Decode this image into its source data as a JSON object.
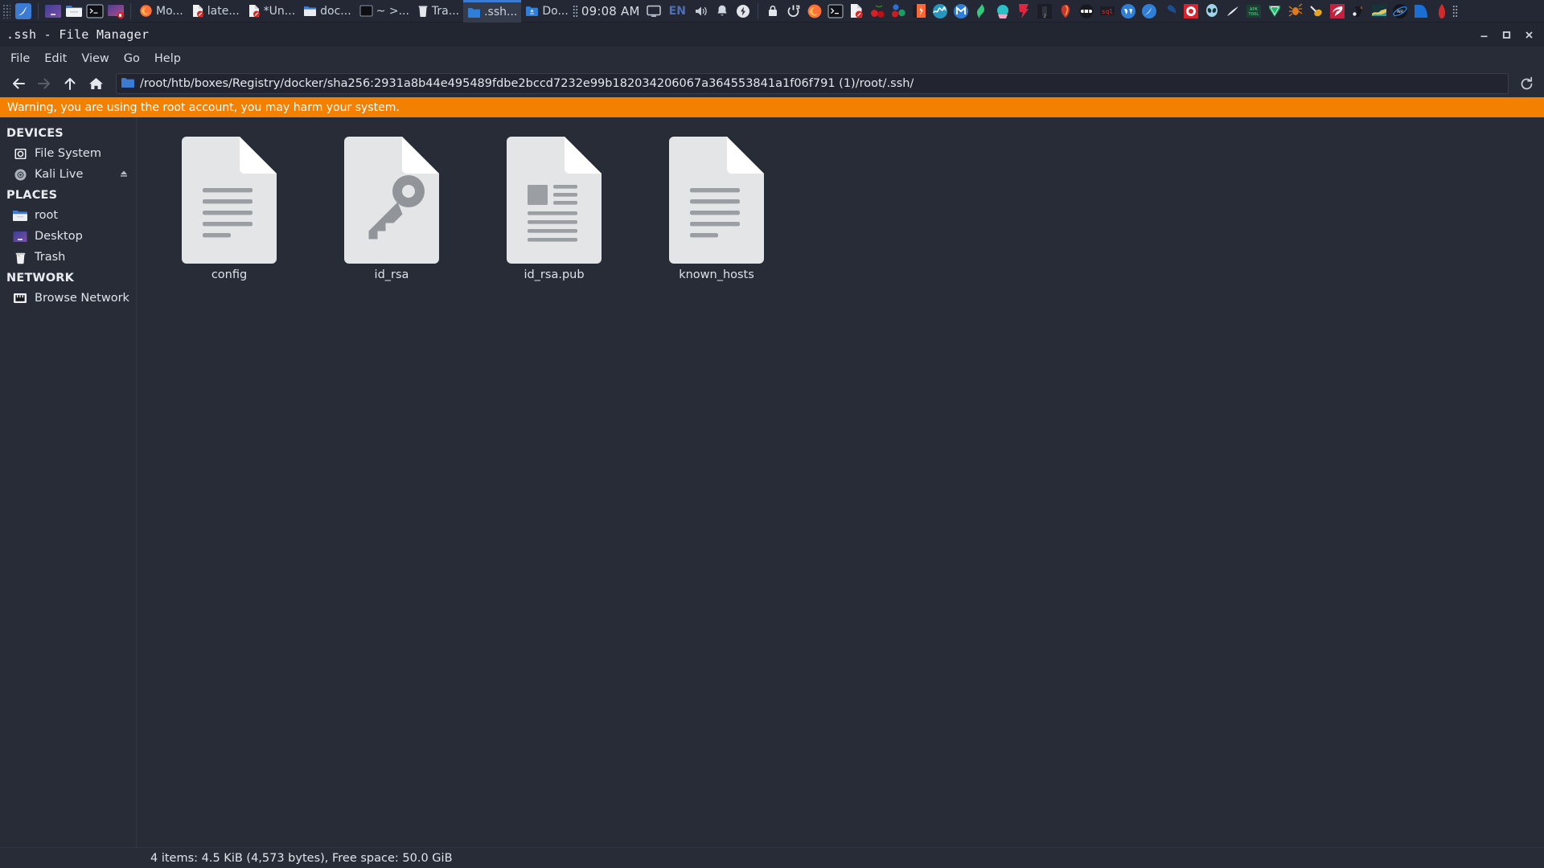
{
  "taskbar": {
    "launchers_left": [
      {
        "name": "kali-menu-icon",
        "glyph": "kali"
      },
      {
        "name": "workspace-switcher-icon",
        "glyph": "workspace"
      },
      {
        "name": "file-manager-launcher-icon",
        "glyph": "folder"
      },
      {
        "name": "terminal-launcher-icon",
        "glyph": "terminal"
      },
      {
        "name": "screen-recorder-launcher-icon",
        "glyph": "screenrec"
      }
    ],
    "windows": [
      {
        "name": "window-button-firefox",
        "label": "Mo...",
        "icon": "firefox",
        "active": false
      },
      {
        "name": "window-button-latest-doc",
        "label": "late...",
        "icon": "document-blocked",
        "active": false
      },
      {
        "name": "window-button-untitled-doc",
        "label": "*Un...",
        "icon": "document-blocked",
        "active": false
      },
      {
        "name": "window-button-doc-folder",
        "label": "doc...",
        "icon": "folder",
        "active": false
      },
      {
        "name": "window-button-terminal",
        "label": "~ >...",
        "icon": "terminal",
        "active": false
      },
      {
        "name": "window-button-trash",
        "label": "Tra...",
        "icon": "trash",
        "active": false
      },
      {
        "name": "window-button-ssh",
        "label": ".ssh...",
        "icon": "folder-blue",
        "active": true
      },
      {
        "name": "window-button-downloads",
        "label": "Do...",
        "icon": "folder-download",
        "active": false
      }
    ],
    "clock": "09:08 AM",
    "language": "EN",
    "tray": [
      {
        "name": "display-tray-icon",
        "glyph": "monitor"
      },
      {
        "name": "language-tray-label",
        "glyph": "lang"
      },
      {
        "name": "volume-tray-icon",
        "glyph": "speaker"
      },
      {
        "name": "notifications-tray-icon",
        "glyph": "bell"
      },
      {
        "name": "power-tray-icon",
        "glyph": "power"
      },
      {
        "name": "lock-screen-icon",
        "glyph": "lock"
      },
      {
        "name": "logout-icon",
        "glyph": "logout"
      }
    ],
    "app_icons": [
      {
        "name": "firefox-icon"
      },
      {
        "name": "terminal-icon"
      },
      {
        "name": "document-blocked-icon"
      },
      {
        "name": "cherrytree-icon"
      },
      {
        "name": "bloodhound-icon"
      },
      {
        "name": "burpsuite-icon"
      },
      {
        "name": "wireshark-icon"
      },
      {
        "name": "metasploit-icon"
      },
      {
        "name": "wpscan-icon"
      },
      {
        "name": "maltego-icon"
      },
      {
        "name": "faraday-icon"
      },
      {
        "name": "johnny-icon"
      },
      {
        "name": "armitage-icon"
      },
      {
        "name": "hashcat-icon"
      },
      {
        "name": "sqlmap-icon"
      },
      {
        "name": "wordpress-icon"
      },
      {
        "name": "kali-tools-icon"
      },
      {
        "name": "beef-icon"
      },
      {
        "name": "zenmap-icon"
      },
      {
        "name": "alien-icon"
      },
      {
        "name": "aircrack-icon"
      },
      {
        "name": "apktool-icon"
      },
      {
        "name": "vim-icon"
      },
      {
        "name": "spider-icon"
      },
      {
        "name": "wasp-icon"
      },
      {
        "name": "zap-icon"
      },
      {
        "name": "dog-icon"
      },
      {
        "name": "chart-icon"
      },
      {
        "name": "air-icon"
      },
      {
        "name": "arc-icon"
      },
      {
        "name": "tower-icon"
      },
      {
        "name": "grip-dots-icon"
      }
    ]
  },
  "window": {
    "title": ".ssh - File Manager",
    "controls": [
      {
        "name": "minimize-button",
        "label": "–"
      },
      {
        "name": "maximize-button",
        "label": "□"
      },
      {
        "name": "close-button",
        "label": "✕"
      }
    ]
  },
  "menubar": {
    "items": [
      {
        "name": "menu-file",
        "label": "File"
      },
      {
        "name": "menu-edit",
        "label": "Edit"
      },
      {
        "name": "menu-view",
        "label": "View"
      },
      {
        "name": "menu-go",
        "label": "Go"
      },
      {
        "name": "menu-help",
        "label": "Help"
      }
    ]
  },
  "pathbar": {
    "back": "back-button",
    "forward": "forward-button",
    "up": "up-button",
    "home": "home-button",
    "path": "/root/htb/boxes/Registry/docker/sha256:2931a8b44e495489fdbe2bccd7232e99b182034206067a364553841a1f06f791 (1)/root/.ssh/",
    "reload": "reload-button"
  },
  "warning": {
    "text": "Warning, you are using the root account, you may harm your system.",
    "background": "#f48000"
  },
  "sidebar": {
    "sections": [
      {
        "name": "devices",
        "title": "DEVICES",
        "items": [
          {
            "name": "sidebar-item-file-system",
            "label": "File System",
            "icon": "harddisk-icon",
            "eject": false
          },
          {
            "name": "sidebar-item-kali-live",
            "label": "Kali Live",
            "icon": "disc-icon",
            "eject": true
          }
        ]
      },
      {
        "name": "places",
        "title": "PLACES",
        "items": [
          {
            "name": "sidebar-item-root",
            "label": "root",
            "icon": "folder-icon",
            "eject": false
          },
          {
            "name": "sidebar-item-desktop",
            "label": "Desktop",
            "icon": "desktop-icon",
            "eject": false
          },
          {
            "name": "sidebar-item-trash",
            "label": "Trash",
            "icon": "trash-icon",
            "eject": false
          }
        ]
      },
      {
        "name": "network",
        "title": "NETWORK",
        "items": [
          {
            "name": "sidebar-item-browse-network",
            "label": "Browse Network",
            "icon": "network-icon",
            "eject": false
          }
        ]
      }
    ]
  },
  "files": [
    {
      "name": "config",
      "icon": "text-document-icon"
    },
    {
      "name": "id_rsa",
      "icon": "key-document-icon"
    },
    {
      "name": "id_rsa.pub",
      "icon": "richtext-document-icon"
    },
    {
      "name": "known_hosts",
      "icon": "text-document-icon"
    }
  ],
  "statusbar": {
    "text": "4 items: 4.5 KiB (4,573 bytes), Free space: 50.0 GiB"
  },
  "colors": {
    "window_bg": "#282c37",
    "taskbar_bg": "#232834",
    "warning_bg": "#f48000",
    "accent": "#3b7bd4",
    "text": "#dfe4ea"
  }
}
